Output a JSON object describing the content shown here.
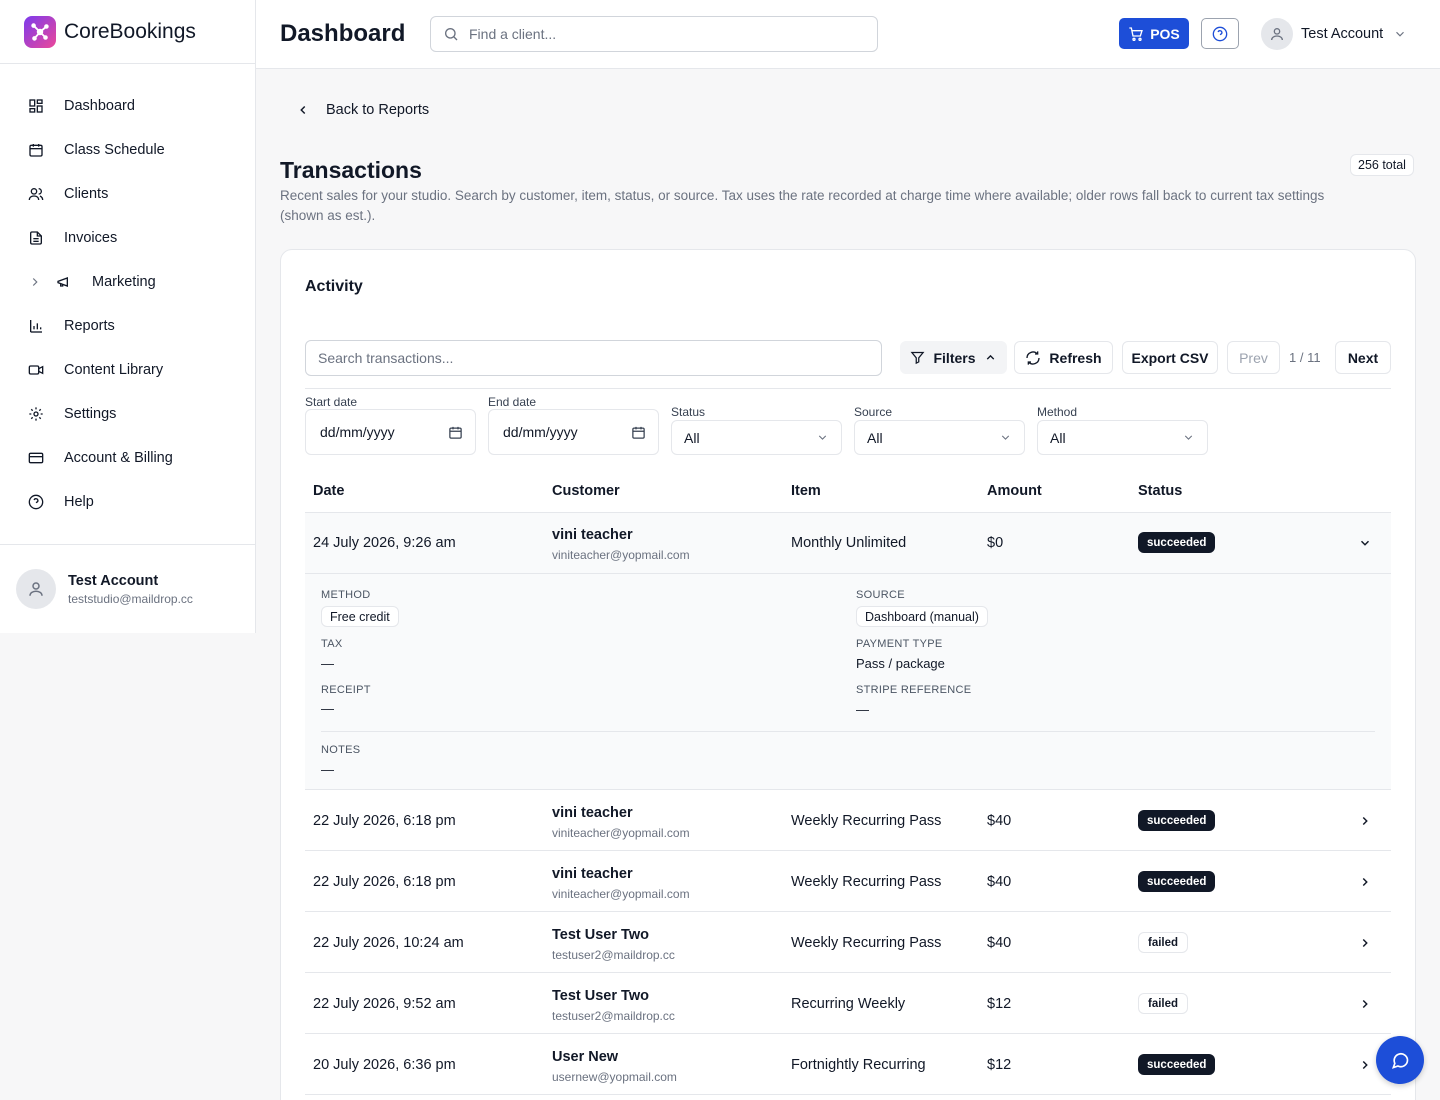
{
  "brand": {
    "name": "CoreBookings"
  },
  "sidebar": {
    "items": [
      {
        "label": "Dashboard",
        "icon": "layout-grid-icon"
      },
      {
        "label": "Class Schedule",
        "icon": "calendar-icon"
      },
      {
        "label": "Clients",
        "icon": "users-icon"
      },
      {
        "label": "Invoices",
        "icon": "file-text-icon"
      },
      {
        "label": "Marketing",
        "icon": "megaphone-icon"
      },
      {
        "label": "Reports",
        "icon": "bar-chart-icon"
      },
      {
        "label": "Content Library",
        "icon": "video-icon"
      },
      {
        "label": "Settings",
        "icon": "gear-icon"
      },
      {
        "label": "Account & Billing",
        "icon": "credit-card-icon"
      },
      {
        "label": "Help",
        "icon": "help-circle-icon"
      }
    ],
    "user": {
      "name": "Test Account",
      "email": "teststudio@maildrop.cc"
    }
  },
  "topbar": {
    "title": "Dashboard",
    "search_placeholder": "Find a client...",
    "pos_label": "POS",
    "account_name": "Test Account"
  },
  "page": {
    "back_label": "Back to Reports",
    "title": "Transactions",
    "total_badge": "256 total",
    "description": "Recent sales for your studio. Search by customer, item, status, or source. Tax uses the rate recorded at charge time where available; older rows fall back to current tax settings (shown as est.)."
  },
  "activity": {
    "title": "Activity",
    "search_placeholder": "Search transactions...",
    "filters_label": "Filters",
    "refresh_label": "Refresh",
    "export_label": "Export CSV",
    "prev_label": "Prev",
    "page_indicator": "1 / 11",
    "next_label": "Next",
    "filters": {
      "start_date_label": "Start date",
      "start_date_value": "dd/mm/yyyy",
      "end_date_label": "End date",
      "end_date_value": "dd/mm/yyyy",
      "status_label": "Status",
      "status_value": "All",
      "source_label": "Source",
      "source_value": "All",
      "method_label": "Method",
      "method_value": "All"
    },
    "columns": [
      "Date",
      "Customer",
      "Item",
      "Amount",
      "Status"
    ],
    "rows": [
      {
        "date": "24 July 2026, 9:26 am",
        "name": "vini teacher",
        "email": "viniteacher@yopmail.com",
        "item": "Monthly Unlimited",
        "amount": "$0",
        "status": "succeeded"
      },
      {
        "date": "22 July 2026, 6:18 pm",
        "name": "vini teacher",
        "email": "viniteacher@yopmail.com",
        "item": "Weekly Recurring Pass",
        "amount": "$40",
        "status": "succeeded"
      },
      {
        "date": "22 July 2026, 6:18 pm",
        "name": "vini teacher",
        "email": "viniteacher@yopmail.com",
        "item": "Weekly Recurring Pass",
        "amount": "$40",
        "status": "succeeded"
      },
      {
        "date": "22 July 2026, 10:24 am",
        "name": "Test User Two",
        "email": "testuser2@maildrop.cc",
        "item": "Weekly Recurring Pass",
        "amount": "$40",
        "status": "failed"
      },
      {
        "date": "22 July 2026, 9:52 am",
        "name": "Test User Two",
        "email": "testuser2@maildrop.cc",
        "item": "Recurring Weekly",
        "amount": "$12",
        "status": "failed"
      },
      {
        "date": "20 July 2026, 6:36 pm",
        "name": "User New",
        "email": "usernew@yopmail.com",
        "item": "Fortnightly Recurring",
        "amount": "$12",
        "status": "succeeded"
      }
    ],
    "details": {
      "method_label": "METHOD",
      "method_value": "Free credit",
      "source_label": "SOURCE",
      "source_value": "Dashboard (manual)",
      "tax_label": "TAX",
      "tax_value": "—",
      "payment_type_label": "PAYMENT TYPE",
      "payment_type_value": "Pass / package",
      "receipt_label": "RECEIPT",
      "receipt_value": "—",
      "stripe_label": "STRIPE REFERENCE",
      "stripe_value": "—",
      "notes_label": "NOTES",
      "notes_value": "—"
    }
  },
  "colors": {
    "accent": "#1d4ed8",
    "success_badge": "#111827"
  }
}
